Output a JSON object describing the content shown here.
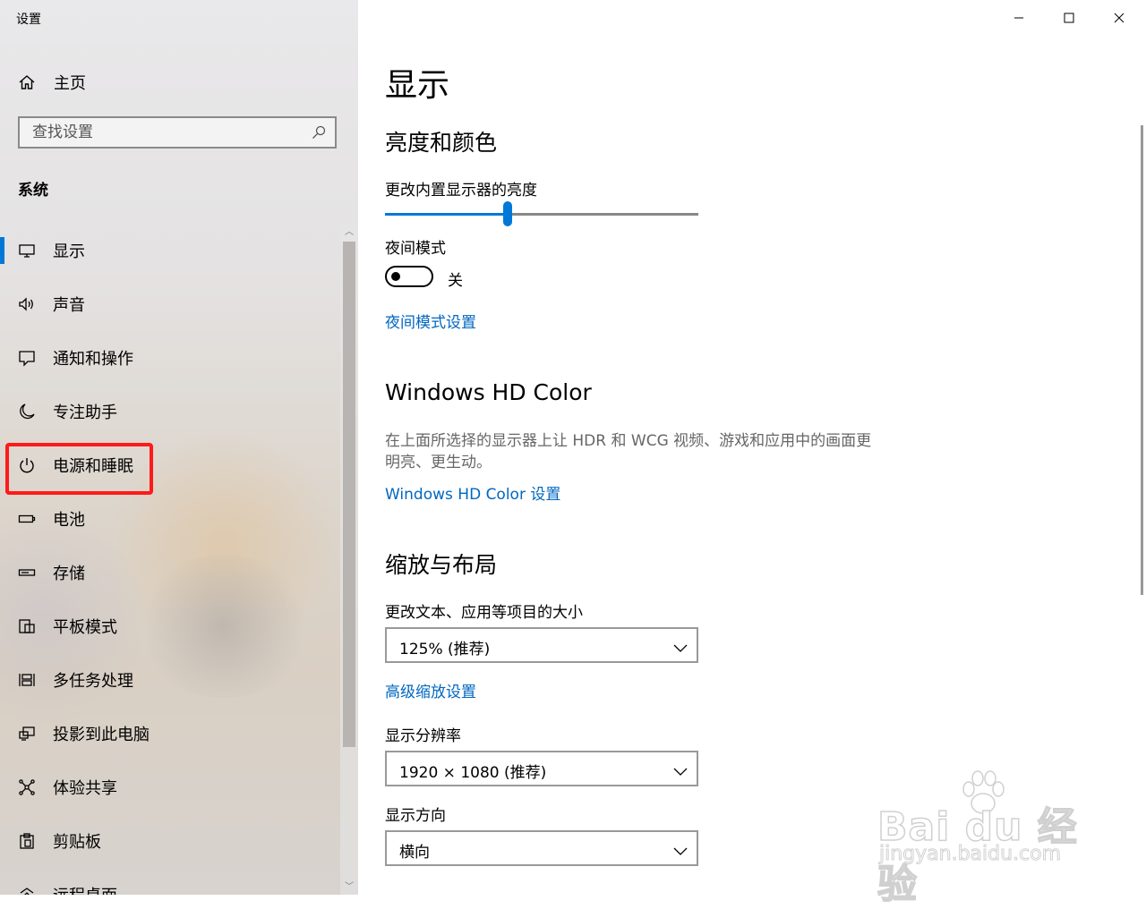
{
  "app": {
    "title": "设置"
  },
  "window_controls": {
    "minimize_icon": "minimize-icon",
    "maximize_icon": "maximize-icon",
    "close_icon": "close-icon"
  },
  "sidebar": {
    "home_label": "主页",
    "search_placeholder": "查找设置",
    "section_label": "系统",
    "items": [
      {
        "label": "显示",
        "icon": "monitor-icon",
        "active": true
      },
      {
        "label": "声音",
        "icon": "speaker-icon"
      },
      {
        "label": "通知和操作",
        "icon": "notification-icon"
      },
      {
        "label": "专注助手",
        "icon": "moon-icon"
      },
      {
        "label": "电源和睡眠",
        "icon": "power-icon",
        "highlighted": true
      },
      {
        "label": "电池",
        "icon": "battery-icon"
      },
      {
        "label": "存储",
        "icon": "storage-icon"
      },
      {
        "label": "平板模式",
        "icon": "tablet-icon"
      },
      {
        "label": "多任务处理",
        "icon": "multitask-icon"
      },
      {
        "label": "投影到此电脑",
        "icon": "project-icon"
      },
      {
        "label": "体验共享",
        "icon": "share-icon"
      },
      {
        "label": "剪贴板",
        "icon": "clipboard-icon"
      },
      {
        "label": "远程桌面",
        "icon": "remote-desktop-icon"
      }
    ]
  },
  "main": {
    "title": "显示",
    "brightness_section": {
      "heading": "亮度和颜色",
      "brightness_label": "更改内置显示器的亮度",
      "brightness_value": 0.39,
      "night_mode_label": "夜间模式",
      "night_mode_state": "关",
      "night_mode_link": "夜间模式设置"
    },
    "hdr_section": {
      "heading": "Windows HD Color",
      "description": "在上面所选择的显示器上让 HDR 和 WCG 视频、游戏和应用中的画面更明亮、更生动。",
      "link": "Windows HD Color 设置"
    },
    "scale_section": {
      "heading": "缩放与布局",
      "scale_label": "更改文本、应用等项目的大小",
      "scale_value": "125% (推荐)",
      "advanced_link": "高级缩放设置",
      "resolution_label": "显示分辨率",
      "resolution_value": "1920 × 1080 (推荐)",
      "orientation_label": "显示方向",
      "orientation_value": "横向"
    }
  },
  "watermark": {
    "brand": "Bai du 经验",
    "url": "jingyan.baidu.com"
  },
  "colors": {
    "accent": "#0078d7",
    "link": "#0067c0",
    "highlight": "#ff1a1a"
  }
}
